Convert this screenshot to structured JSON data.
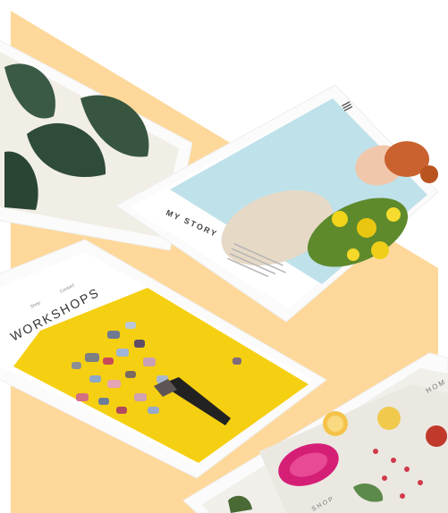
{
  "brand_colors": {
    "band": "#fdd89a",
    "yellow": "#f5cf12",
    "sky": "#bfe1ea"
  },
  "story_card": {
    "menu_icon": "hamburger-icon",
    "title": "MY STORY"
  },
  "workshops_card": {
    "title": "WORKSHOPS",
    "nav": [
      "Shop",
      "Contact"
    ]
  },
  "shop_card": {
    "label_right": "HOM",
    "label_bottom": "SHOP"
  }
}
